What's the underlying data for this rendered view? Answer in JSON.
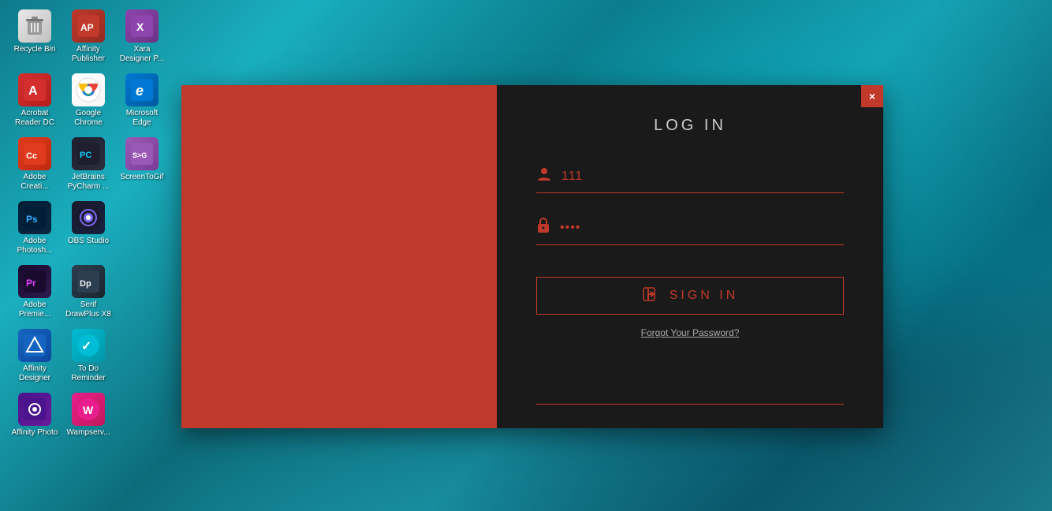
{
  "desktop": {
    "icons": [
      {
        "id": "recycle-bin",
        "label": "Recycle Bin",
        "colorClass": "icon-recycle",
        "symbol": "🗑️",
        "row": 0
      },
      {
        "id": "affinity-publisher",
        "label": "Affinity Publisher",
        "colorClass": "icon-affinity-pub",
        "symbol": "AP",
        "row": 0
      },
      {
        "id": "xara-designer",
        "label": "Xara Designer P...",
        "colorClass": "icon-xara",
        "symbol": "X",
        "row": 0
      },
      {
        "id": "acrobat-reader",
        "label": "Acrobat Reader DC",
        "colorClass": "icon-acrobat",
        "symbol": "A",
        "row": 1
      },
      {
        "id": "google-chrome",
        "label": "Google Chrome",
        "colorClass": "icon-chrome",
        "symbol": "⊙",
        "row": 1
      },
      {
        "id": "microsoft-edge",
        "label": "Microsoft Edge",
        "colorClass": "icon-edge",
        "symbol": "e",
        "row": 1
      },
      {
        "id": "adobe-creative",
        "label": "Adobe Creati...",
        "colorClass": "icon-adobe-cc",
        "symbol": "Cc",
        "row": 2
      },
      {
        "id": "pycharm",
        "label": "JetBrains PyCharm ...",
        "colorClass": "icon-pycharm",
        "symbol": "PC",
        "row": 2
      },
      {
        "id": "screentogif",
        "label": "ScreenToGif",
        "colorClass": "icon-screentogif",
        "symbol": "S>G",
        "row": 2
      },
      {
        "id": "adobe-photoshop",
        "label": "Adobe Photosh...",
        "colorClass": "icon-photoshop",
        "symbol": "Ps",
        "row": 3
      },
      {
        "id": "obs-studio",
        "label": "OBS Studio",
        "colorClass": "icon-obs",
        "symbol": "⊙",
        "row": 3
      },
      {
        "id": "adobe-premiere",
        "label": "Adobe Premie...",
        "colorClass": "icon-premiere",
        "symbol": "Pr",
        "row": 4
      },
      {
        "id": "serif-drawplus",
        "label": "Serif DrawPlus X8",
        "colorClass": "icon-drawplus",
        "symbol": "Dp",
        "row": 4
      },
      {
        "id": "affinity-designer",
        "label": "Affinity Designer",
        "colorClass": "icon-aff-designer",
        "symbol": "AD",
        "row": 5
      },
      {
        "id": "todo-reminder",
        "label": "To Do Reminder",
        "colorClass": "icon-todo",
        "symbol": "✓",
        "row": 5
      },
      {
        "id": "affinity-photo",
        "label": "Affinity Photo",
        "colorClass": "icon-aff-photo",
        "symbol": "Ph",
        "row": 6
      },
      {
        "id": "wampserver",
        "label": "Wampserv...",
        "colorClass": "icon-wamp",
        "symbol": "W",
        "row": 6
      }
    ]
  },
  "login": {
    "title": "LOG IN",
    "username_value": "111",
    "password_value": "4301",
    "username_placeholder": "111",
    "password_placeholder": "4301",
    "sign_in_label": "SIGN IN",
    "forgot_password_text": "Forgot Your Password?",
    "forgot_password_pre": "Forgot ",
    "forgot_password_link": "Your Password",
    "forgot_password_post": "?",
    "close_label": "×"
  }
}
